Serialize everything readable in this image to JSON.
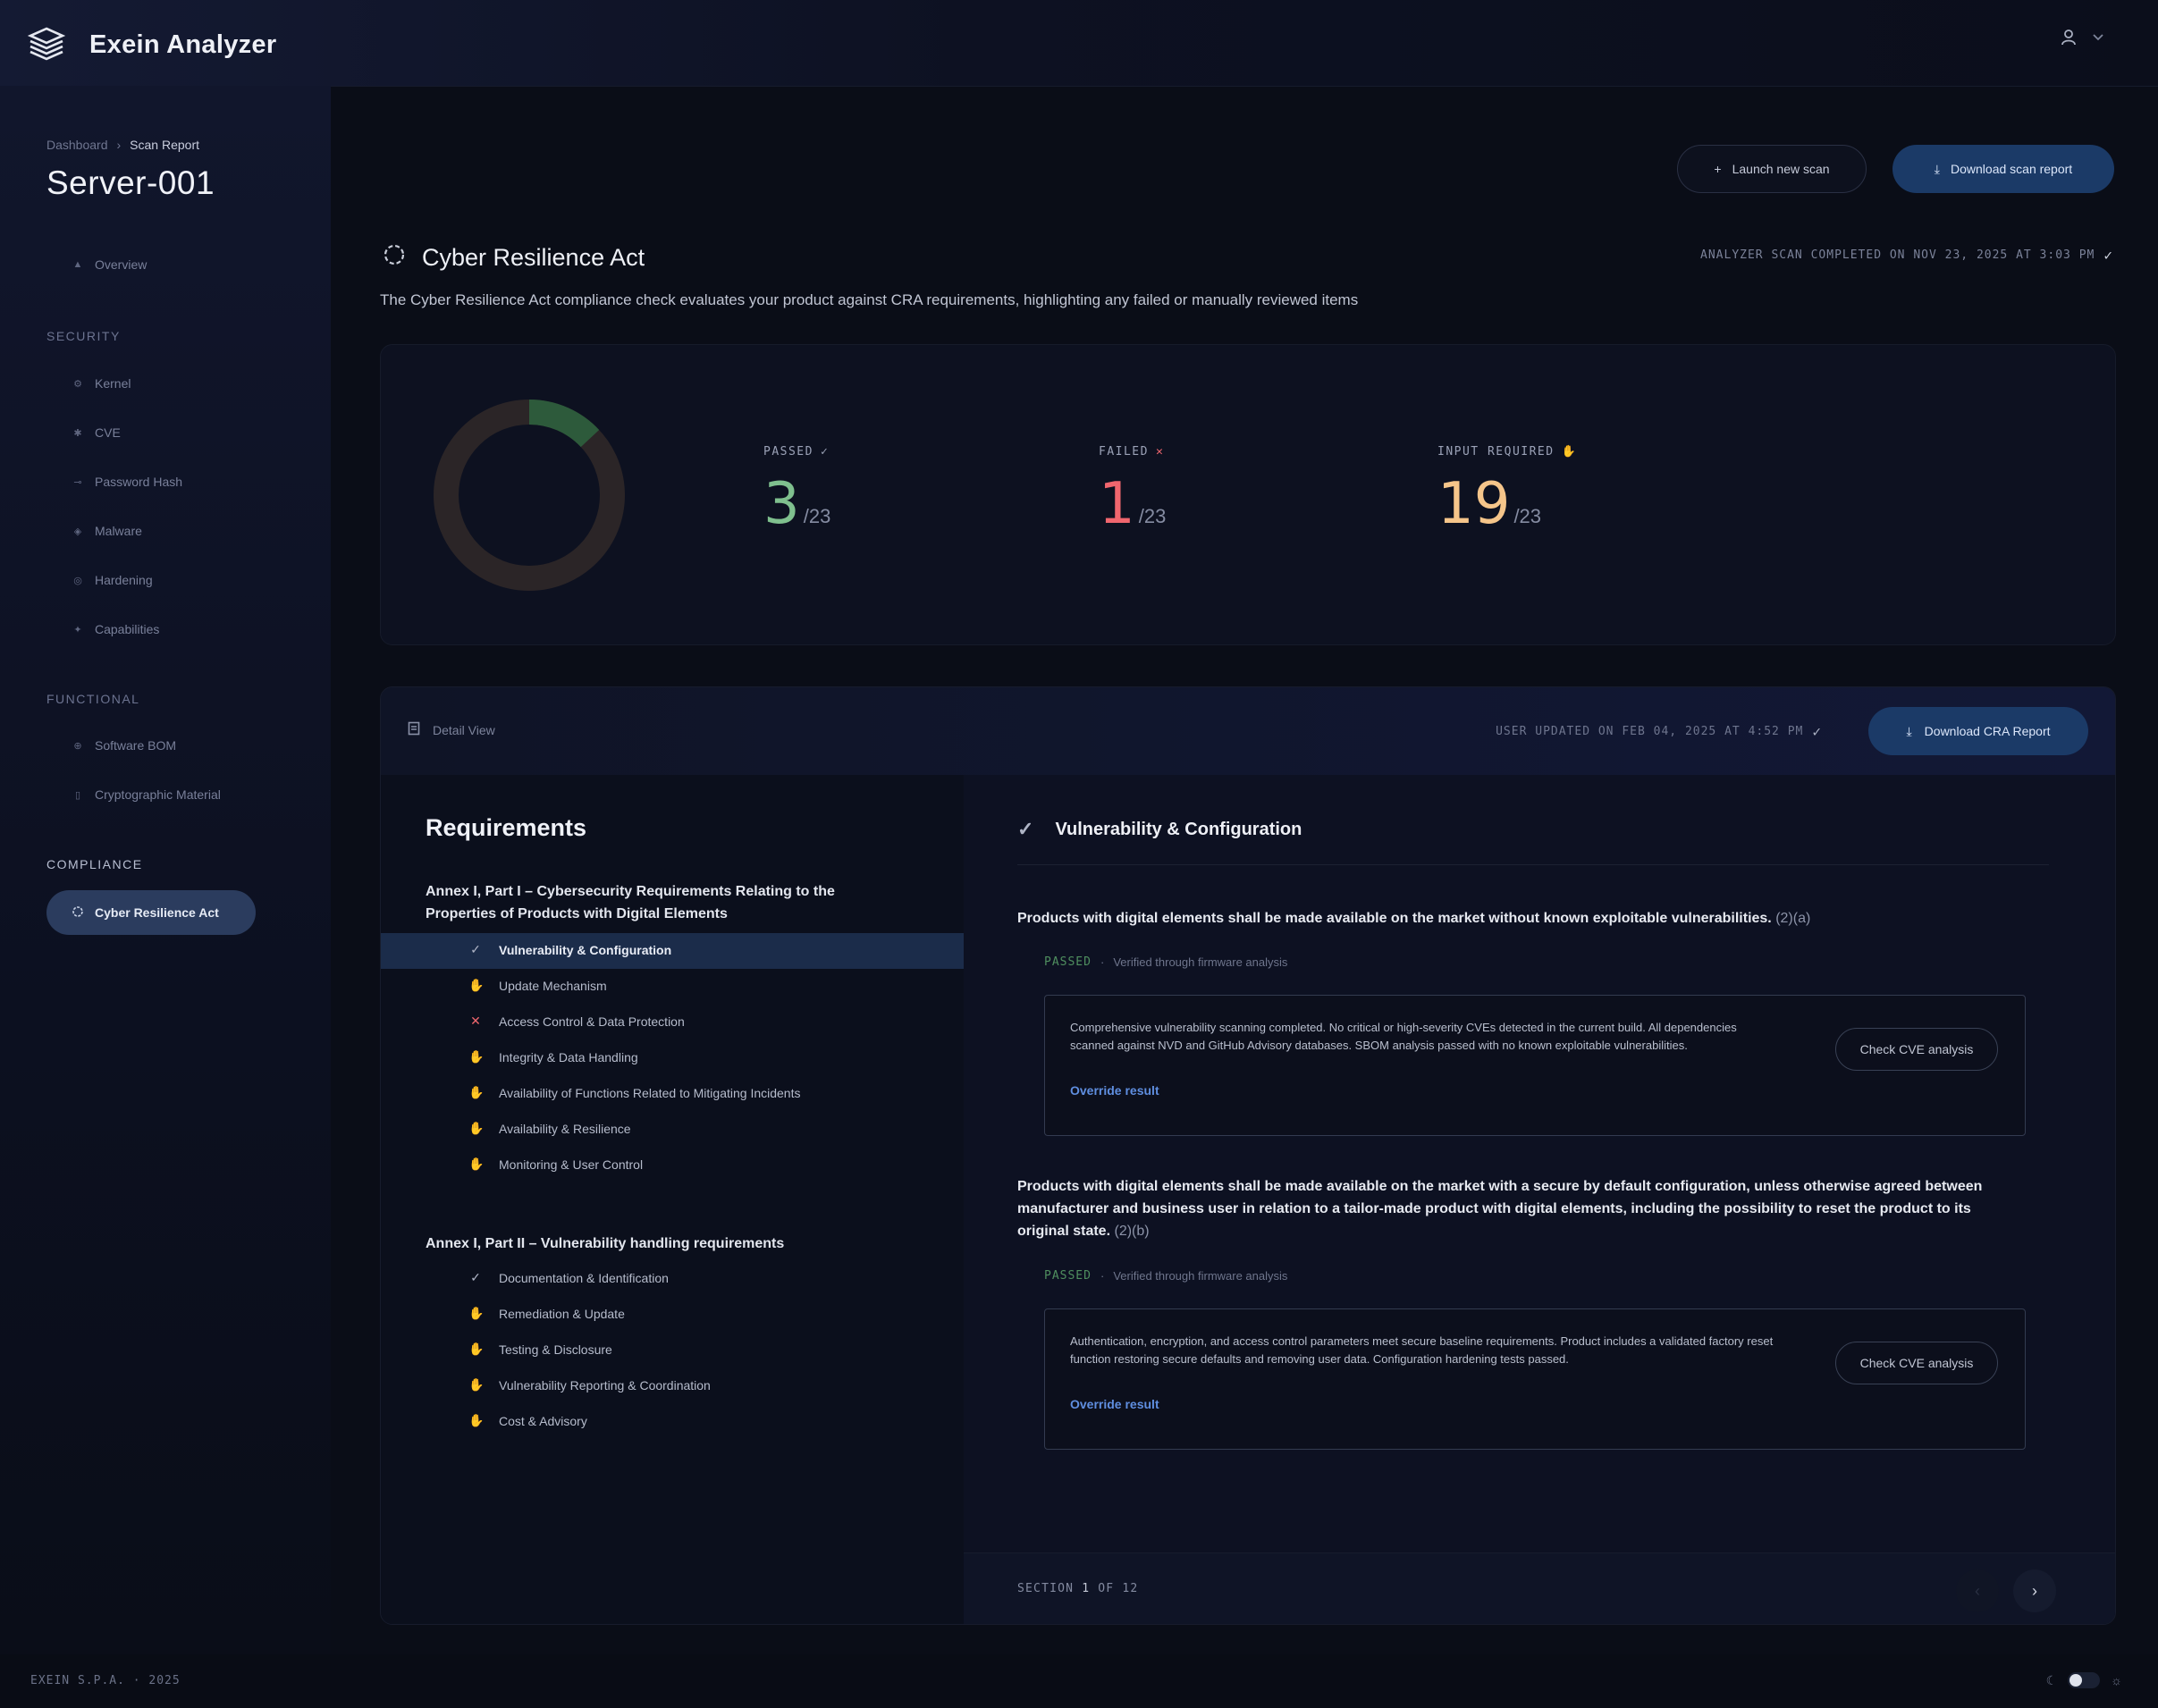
{
  "app": {
    "name": "Exein Analyzer"
  },
  "breadcrumb": {
    "root": "Dashboard",
    "current": "Scan Report"
  },
  "page": {
    "title": "Server-001"
  },
  "sidebar": {
    "overview": "Overview",
    "security_label": "SECURITY",
    "security_items": [
      "Kernel",
      "CVE",
      "Password Hash",
      "Malware",
      "Hardening",
      "Capabilities"
    ],
    "functional_label": "FUNCTIONAL",
    "functional_items": [
      "Software BOM",
      "Cryptographic Material"
    ],
    "compliance_label": "COMPLIANCE",
    "active_item": "Cyber Resilience Act"
  },
  "header": {
    "launch_label": "Launch new scan",
    "download_label": "Download scan report"
  },
  "section": {
    "title": "Cyber Resilience Act",
    "description": "The Cyber Resilience Act compliance check evaluates your product against CRA requirements, highlighting any failed or manually reviewed items",
    "completed": "ANALYZER SCAN COMPLETED ON NOV 23, 2025 AT 3:03 PM"
  },
  "stats": {
    "total": 23,
    "passed": {
      "label": "PASSED",
      "value": 3,
      "total_text": "/23"
    },
    "failed": {
      "label": "FAILED",
      "value": 1,
      "total_text": "/23"
    },
    "input": {
      "label": "INPUT REQUIRED",
      "value": 19,
      "total_text": "/23"
    }
  },
  "detail": {
    "view_label": "Detail View",
    "user_updated": "USER UPDATED ON FEB 04, 2025 AT 4:52 PM",
    "download_cra": "Download CRA Report"
  },
  "requirements": {
    "title": "Requirements",
    "annex1": "Annex I, Part I – Cybersecurity Requirements Relating to the Properties of Products with Digital Elements",
    "annex1_items": [
      {
        "label": "Vulnerability & Configuration",
        "status": "passed"
      },
      {
        "label": "Update Mechanism",
        "status": "input"
      },
      {
        "label": "Access Control & Data Protection",
        "status": "failed"
      },
      {
        "label": "Integrity & Data Handling",
        "status": "input"
      },
      {
        "label": "Availability of Functions Related to Mitigating Incidents",
        "status": "input"
      },
      {
        "label": "Availability & Resilience",
        "status": "input"
      },
      {
        "label": "Monitoring & User Control",
        "status": "input"
      }
    ],
    "annex2": "Annex I, Part II – Vulnerability handling requirements",
    "annex2_items": [
      {
        "label": "Documentation & Identification",
        "status": "passed"
      },
      {
        "label": "Remediation & Update",
        "status": "input"
      },
      {
        "label": "Testing & Disclosure",
        "status": "input"
      },
      {
        "label": "Vulnerability Reporting & Coordination",
        "status": "input"
      },
      {
        "label": "Cost & Advisory",
        "status": "input"
      }
    ]
  },
  "content": {
    "title": "Vulnerability & Configuration",
    "req1": {
      "text": "Products with digital elements shall be made available on the market without known exploitable vulnerabilities.",
      "ref": "(2)(a)",
      "status": "PASSED",
      "verified": "Verified through firmware analysis",
      "result": "Comprehensive vulnerability scanning completed. No critical or high-severity CVEs detected in the current build. All dependencies scanned against NVD and GitHub Advisory databases. SBOM analysis passed with no known exploitable vulnerabilities.",
      "override": "Override result",
      "check": "Check CVE analysis"
    },
    "req2": {
      "text": "Products with digital elements shall be made available on the market with a secure by default configuration, unless otherwise agreed between manufacturer and business user in relation to a tailor-made product with digital elements, including the possibility to reset the product to its original state.",
      "ref": "(2)(b)",
      "status": "PASSED",
      "verified": "Verified through firmware analysis",
      "result": "Authentication, encryption, and access control parameters meet secure baseline requirements. Product includes a validated factory reset function restoring secure defaults and removing user data. Configuration hardening tests passed.",
      "override": "Override result",
      "check": "Check CVE analysis"
    },
    "pager": {
      "section_word": "SECTION",
      "current": "1",
      "of_word": "OF",
      "total": "12"
    }
  },
  "footer": {
    "text": "EXEIN S.P.A. · 2025"
  },
  "colors": {
    "passed": "#7fc08e",
    "failed": "#f0666e",
    "input": "#f5c58a",
    "donut_passed": "#2d5a3b",
    "donut_track": "#2b2527",
    "accent": "#1b3a67"
  }
}
